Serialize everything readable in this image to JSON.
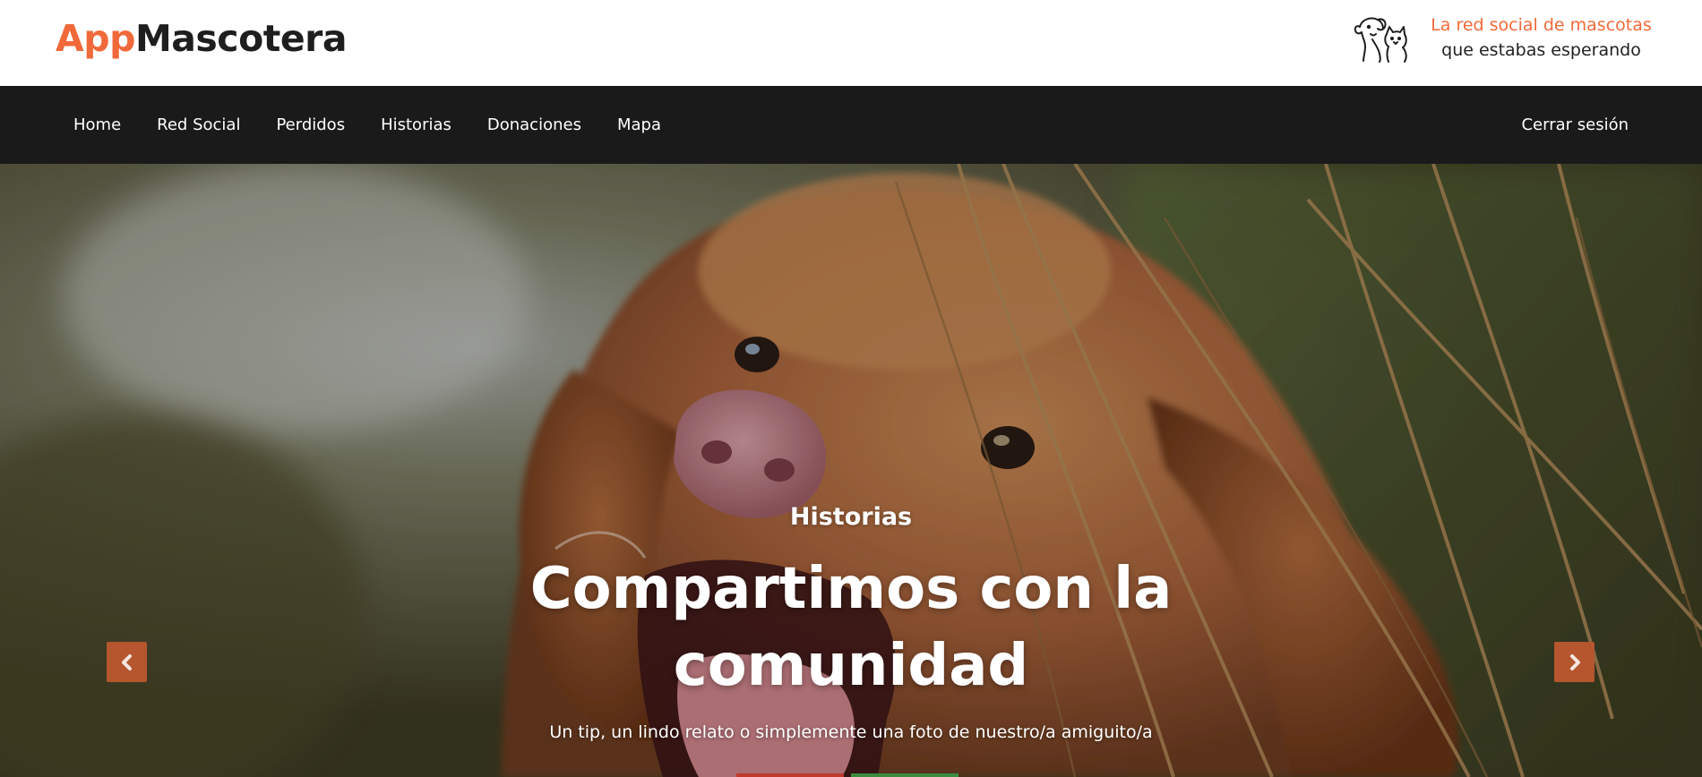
{
  "brand": {
    "name_accent": "App",
    "name_rest": "Mascotera",
    "tagline_line1": "La red social de mascotas",
    "tagline_line2": "que estabas esperando",
    "icon": "dog-and-cat-icon"
  },
  "nav": {
    "items": [
      {
        "label": "Home"
      },
      {
        "label": "Red Social"
      },
      {
        "label": "Perdidos"
      },
      {
        "label": "Historias"
      },
      {
        "label": "Donaciones"
      },
      {
        "label": "Mapa"
      }
    ],
    "logout_label": "Cerrar sesión"
  },
  "hero": {
    "subtitle": "Historias",
    "title": "Compartimos con la comunidad",
    "text": "Un tip, un lindo relato o simplemente una foto de nuestro/a amiguito/a",
    "prev_icon": "chevron-left-icon",
    "next_icon": "chevron-right-icon",
    "indicator_colors": [
      "#c0392b",
      "#3a8c3f"
    ]
  },
  "colors": {
    "accent": "#f0693a",
    "nav_background": "#1a1a1a",
    "carousel_control": "#b5562f"
  }
}
